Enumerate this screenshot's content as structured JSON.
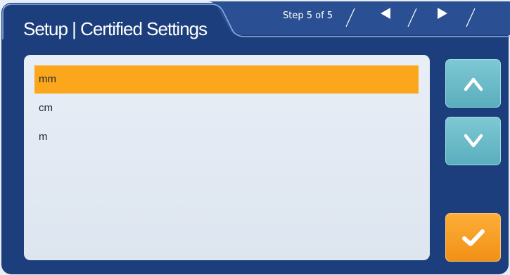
{
  "header": {
    "title": "Setup | Certified Settings",
    "step": "Step 5 of 5"
  },
  "colors": {
    "panel": "#1d3f7d",
    "tab": "#0f2c62",
    "selection": "#fca71b",
    "arrow_button": "#68bac7",
    "confirm_button": "#f59a1e"
  },
  "units_list": {
    "items": [
      {
        "label": "mm",
        "selected": true
      },
      {
        "label": "cm",
        "selected": false
      },
      {
        "label": "m",
        "selected": false
      }
    ]
  },
  "controls": {
    "prev_icon": "triangle-left-icon",
    "next_icon": "triangle-right-icon",
    "up_icon": "chevron-up-icon",
    "down_icon": "chevron-down-icon",
    "confirm_icon": "checkmark-icon"
  }
}
